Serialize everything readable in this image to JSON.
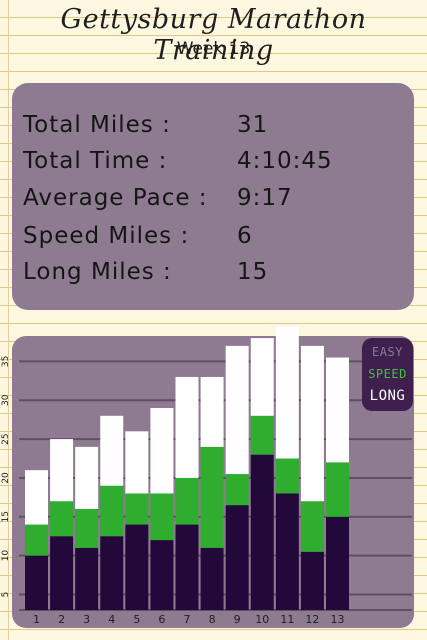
{
  "title": "Gettysburg Marathon Training",
  "subtitle": "Week 13",
  "stats": [
    {
      "label": "Total Miles :",
      "value": "31"
    },
    {
      "label": "Total Time :",
      "value": "4:10:45"
    },
    {
      "label": "Average Pace :",
      "value": "9:17"
    },
    {
      "label": "Speed Miles :",
      "value": "6"
    },
    {
      "label": "Long Miles :",
      "value": "15"
    }
  ],
  "colors": {
    "easy": "#ffffff",
    "speed": "#2ead2e",
    "long": "#23083a",
    "panel": "#8e7b91",
    "gridline": "#5f4f63",
    "legend_bg": "#3e1f4d",
    "legend_easy": "#8e7b91",
    "legend_speed": "#3fc23f",
    "legend_long": "#ffffff"
  },
  "chart_data": {
    "type": "bar",
    "stacked": true,
    "categories": [
      "1",
      "2",
      "3",
      "4",
      "5",
      "6",
      "7",
      "8",
      "9",
      "10",
      "11",
      "12",
      "13"
    ],
    "series": [
      {
        "name": "LONG",
        "values": [
          10,
          12.5,
          11,
          12.5,
          14,
          12,
          14,
          11,
          16.5,
          23,
          18,
          10.5,
          15
        ]
      },
      {
        "name": "SPEED",
        "values": [
          4,
          4.5,
          5,
          6.5,
          4,
          6,
          6,
          13,
          4,
          5,
          4.5,
          6.5,
          7
        ]
      },
      {
        "name": "EASY",
        "values": [
          7,
          8,
          8,
          9,
          8,
          11,
          13,
          9,
          16.5,
          10,
          17,
          20,
          13.5
        ]
      }
    ],
    "yticks": [
      5,
      10,
      15,
      20,
      25,
      30,
      35
    ],
    "ylim": [
      3,
      37.5
    ],
    "grid": true,
    "legend": "top-right",
    "legend_labels": [
      "EASY",
      "SPEED",
      "LONG"
    ]
  }
}
